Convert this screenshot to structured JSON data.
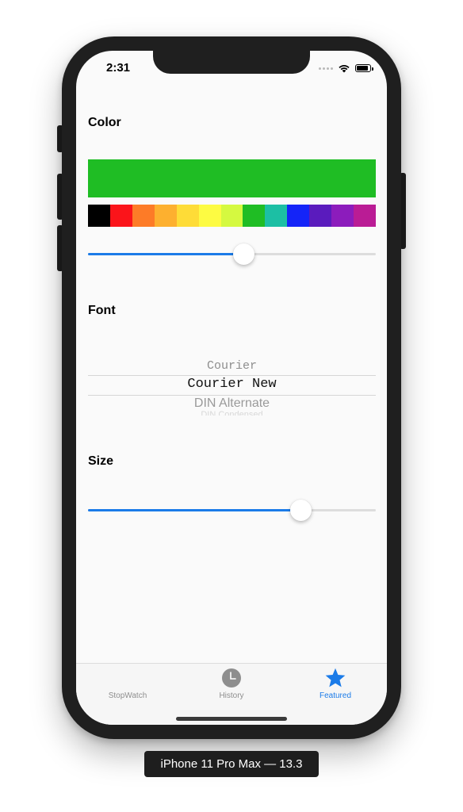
{
  "status_bar": {
    "time": "2:31"
  },
  "sections": {
    "color_title": "Color",
    "font_title": "Font",
    "size_title": "Size"
  },
  "color": {
    "selected": "#1fbd24",
    "palette": [
      "#000000",
      "#fb141a",
      "#fd7b27",
      "#fdb02f",
      "#fedc37",
      "#fdfb42",
      "#d5f940",
      "#1fbd24",
      "#1cbfa4",
      "#1424f8",
      "#5a1bbd",
      "#8c1cbc",
      "#ba1c95"
    ],
    "slider_value": 0.54
  },
  "font": {
    "options": [
      "Courier",
      "Courier New",
      "DIN Alternate",
      "DIN Condensed"
    ],
    "selected": "Courier New"
  },
  "size": {
    "slider_value": 0.74
  },
  "tabbar": {
    "stopwatch_label": "StopWatch",
    "history_label": "History",
    "featured_label": "Featured",
    "active_color": "#1b7be8",
    "inactive_color": "#8e8e8e"
  },
  "device_label": "iPhone 11 Pro Max — 13.3"
}
